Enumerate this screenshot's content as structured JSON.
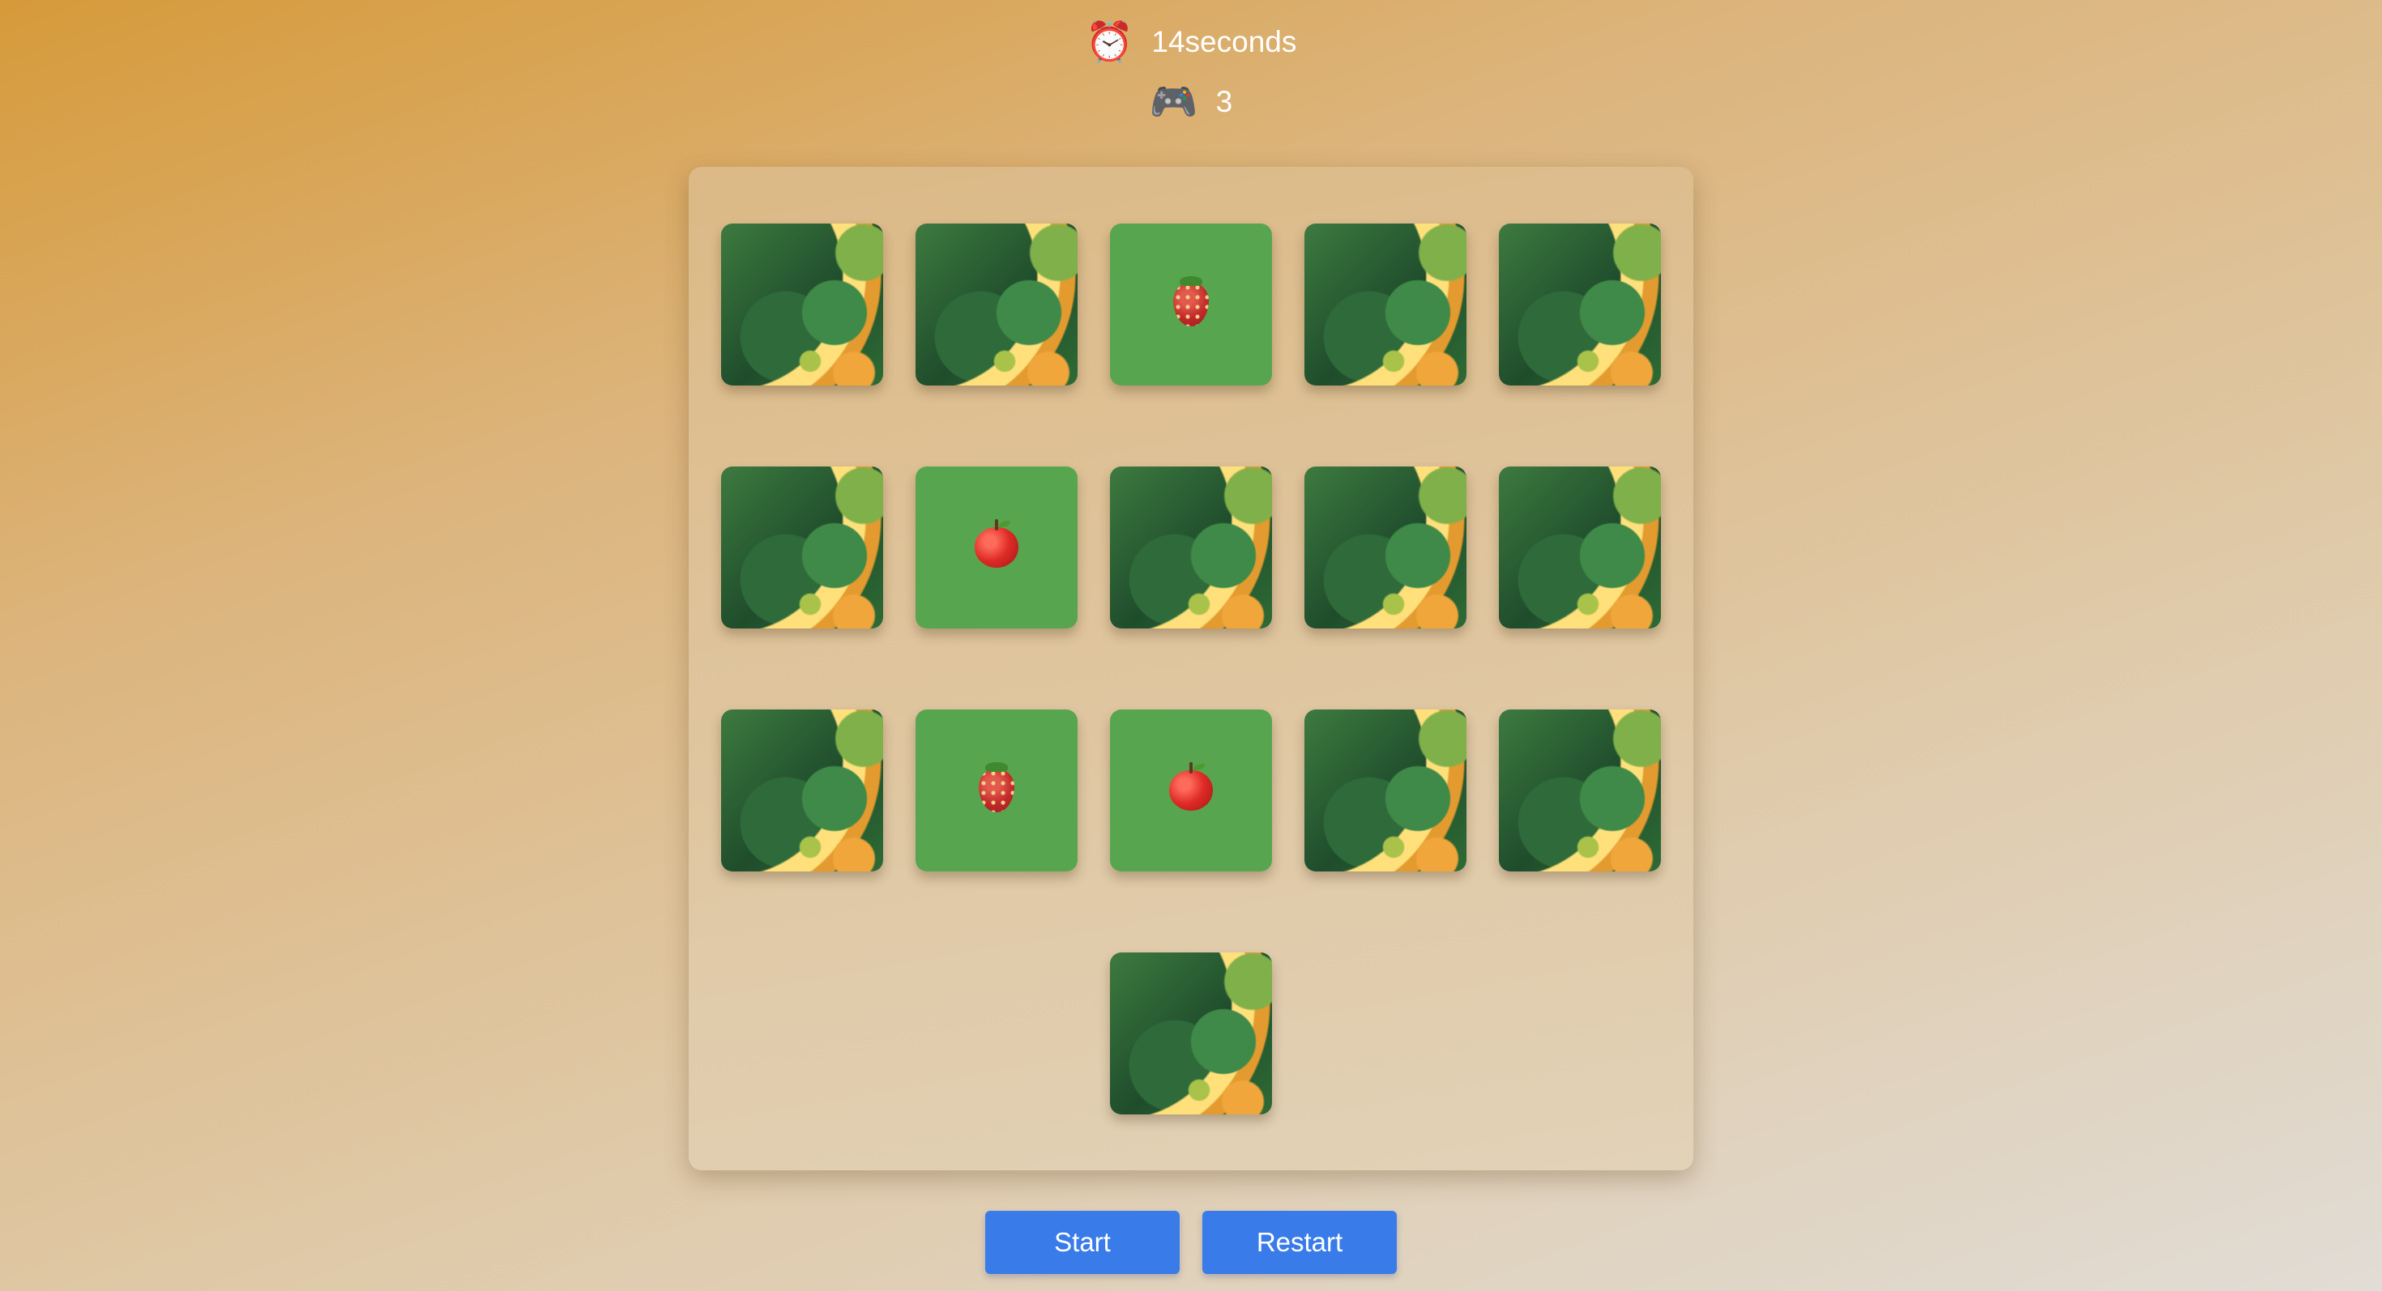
{
  "stats": {
    "timer_icon": "alarm-clock-icon",
    "timer_text": "14seconds",
    "moves_icon": "game-controller-icon",
    "moves_text": "3"
  },
  "board": {
    "columns": 5,
    "cards": [
      {
        "state": "hidden"
      },
      {
        "state": "hidden"
      },
      {
        "state": "revealed",
        "fruit": "strawberry"
      },
      {
        "state": "hidden"
      },
      {
        "state": "hidden"
      },
      {
        "state": "hidden"
      },
      {
        "state": "revealed",
        "fruit": "apple"
      },
      {
        "state": "hidden"
      },
      {
        "state": "hidden"
      },
      {
        "state": "hidden"
      },
      {
        "state": "hidden"
      },
      {
        "state": "revealed",
        "fruit": "strawberry"
      },
      {
        "state": "revealed",
        "fruit": "apple"
      },
      {
        "state": "hidden"
      },
      {
        "state": "hidden"
      },
      {
        "state": "hidden"
      }
    ]
  },
  "controls": {
    "start_label": "Start",
    "restart_label": "Restart"
  },
  "colors": {
    "button": "#3a7bea",
    "revealed_card": "#57a64f",
    "board": "#ddbd8d"
  }
}
